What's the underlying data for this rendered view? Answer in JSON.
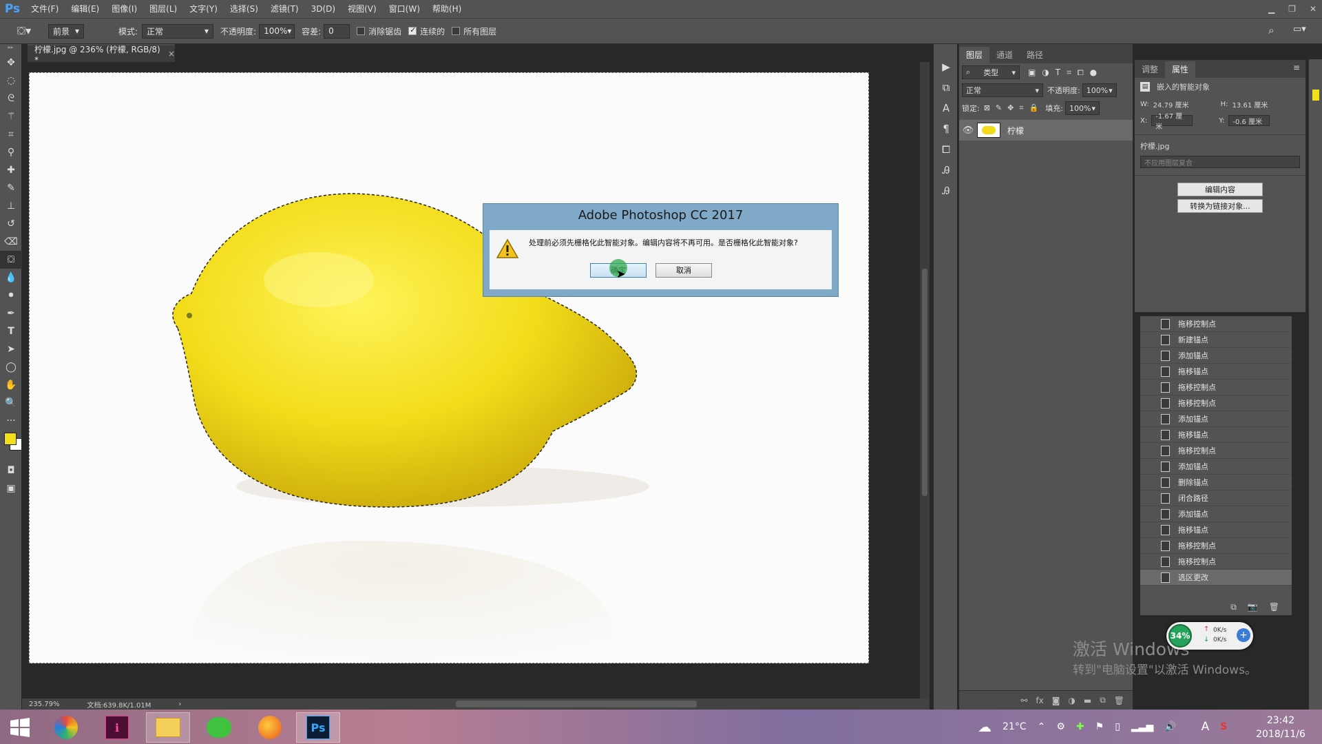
{
  "app": {
    "logo": "Ps",
    "menu": [
      "文件(F)",
      "编辑(E)",
      "图像(I)",
      "图层(L)",
      "文字(Y)",
      "选择(S)",
      "滤镜(T)",
      "3D(D)",
      "视图(V)",
      "窗口(W)",
      "帮助(H)"
    ]
  },
  "options": {
    "fill_source": "前景",
    "mode_label": "模式:",
    "mode_value": "正常",
    "opacity_label": "不透明度:",
    "opacity_value": "100%",
    "tolerance_label": "容差:",
    "tolerance_value": "0",
    "antialias_label": "消除锯齿",
    "antialias_checked": false,
    "contiguous_label": "连续的",
    "contiguous_checked": true,
    "all_layers_label": "所有图层",
    "all_layers_checked": false
  },
  "document": {
    "tab_title": "柠檬.jpg @ 236% (柠檬, RGB/8) *",
    "close_glyph": "×"
  },
  "status": {
    "zoom": "235.79%",
    "doc_info": "文档:639.8K/1.01M"
  },
  "layers": {
    "tabs": [
      "图层",
      "通道",
      "路径"
    ],
    "filter_kind": "类型",
    "blend_mode": "正常",
    "opacity_label": "不透明度:",
    "opacity_value": "100%",
    "lock_label": "锁定:",
    "fill_label": "填充:",
    "fill_value": "100%",
    "layer_name": "柠檬"
  },
  "properties": {
    "tabs": [
      "调整",
      "属性"
    ],
    "type_label": "嵌入的智能对象",
    "w_label": "W:",
    "w_value": "24.79 厘米",
    "h_label": "H:",
    "h_value": "13.61 厘米",
    "x_label": "X:",
    "x_value": "-1.67 厘米",
    "y_label": "Y:",
    "y_value": "-0.6 厘米",
    "filename": "柠檬.jpg",
    "comp_placeholder": "不应用图层复合",
    "edit_btn": "编辑内容",
    "convert_btn": "转换为链接对象..."
  },
  "history": {
    "items": [
      "拖移控制点",
      "新建锚点",
      "添加锚点",
      "拖移锚点",
      "拖移控制点",
      "拖移控制点",
      "添加锚点",
      "拖移锚点",
      "拖移控制点",
      "添加锚点",
      "删除锚点",
      "闭合路径",
      "添加锚点",
      "拖移锚点",
      "拖移控制点",
      "拖移控制点",
      "选区更改"
    ],
    "selected_index": 16
  },
  "dialog": {
    "title": "Adobe Photoshop CC 2017",
    "message": "处理前必须先栅格化此智能对象。编辑内容将不再可用。是否栅格化此智能对象?",
    "ok_label": "确定",
    "cancel_label": "取消"
  },
  "activation": {
    "line1": "激活 Windows",
    "line2": "转到\"电脑设置\"以激活 Windows。"
  },
  "net_widget": {
    "percent": "34%",
    "up": "0K/s",
    "down": "0K/s"
  },
  "tray": {
    "temperature": "21°C",
    "time": "23:42",
    "date": "2018/11/6"
  },
  "colors": {
    "foreground": "#f4e019",
    "background": "#ffffff",
    "lemon": "#f2dc1a",
    "dialog_frame": "#7fa9c7"
  }
}
